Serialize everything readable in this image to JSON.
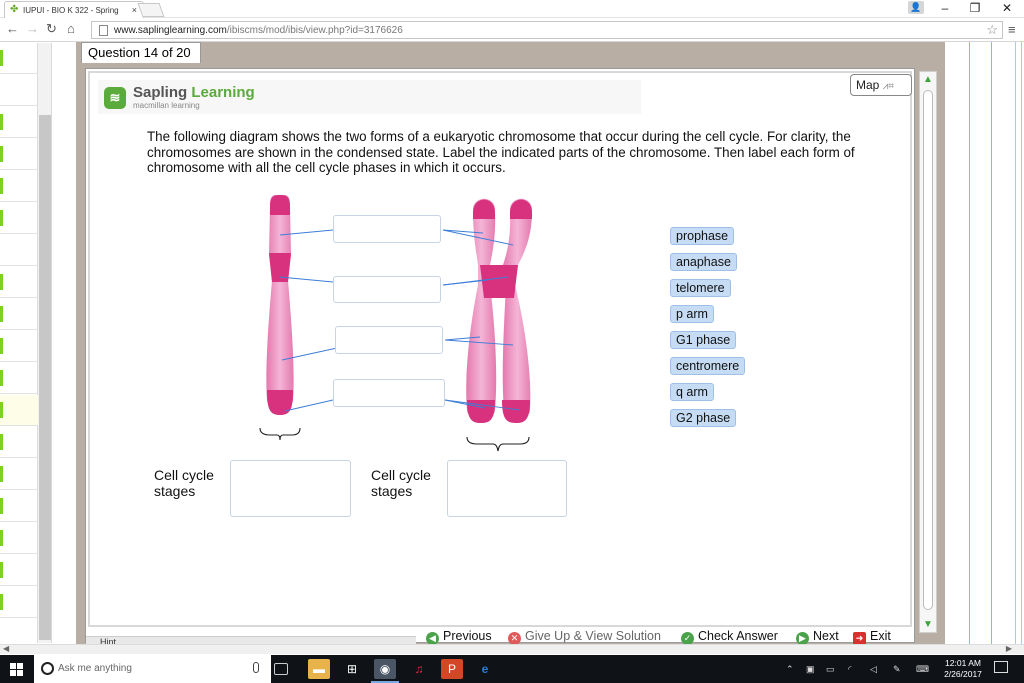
{
  "browser": {
    "tab_title": "IUPUI - BIO K 322 - Spring",
    "url_host": "www.saplinglearning.com",
    "url_path": "/ibiscms/mod/ibis/view.php?id=3176626"
  },
  "question": {
    "tab_label": "Question 14 of 20",
    "text": "The following diagram shows the two forms of a eukaryotic chromosome that occur during the cell cycle. For clarity, the chromosomes are shown in the condensed state. Label the indicated parts of the chromosome. Then label each form of chromosome with all the cell cycle phases in which it occurs.",
    "stage_label_left": "Cell cycle stages",
    "stage_label_right": "Cell cycle stages",
    "map_label": "Map"
  },
  "logo": {
    "brand_a": "Sapling ",
    "brand_b": "Learning",
    "sub": "macmillan learning"
  },
  "word_bank": [
    {
      "label": "prophase"
    },
    {
      "label": "anaphase"
    },
    {
      "label": "telomere"
    },
    {
      "label": "p arm"
    },
    {
      "label": "G1 phase"
    },
    {
      "label": "centromere"
    },
    {
      "label": "q arm"
    },
    {
      "label": "G2 phase"
    }
  ],
  "nav": {
    "previous": "Previous",
    "give_up": "Give Up & View Solution",
    "check": "Check Answer",
    "next": "Next",
    "exit": "Exit",
    "hint": "Hint"
  },
  "taskbar": {
    "search_placeholder": "Ask me anything",
    "time": "12:01 AM",
    "date": "2/26/2017"
  },
  "colors": {
    "chromosome_pink": "#e87db4",
    "chromosome_dark": "#d8327e",
    "chip_bg": "#c5dcf4",
    "green": "#5aaa3c"
  }
}
